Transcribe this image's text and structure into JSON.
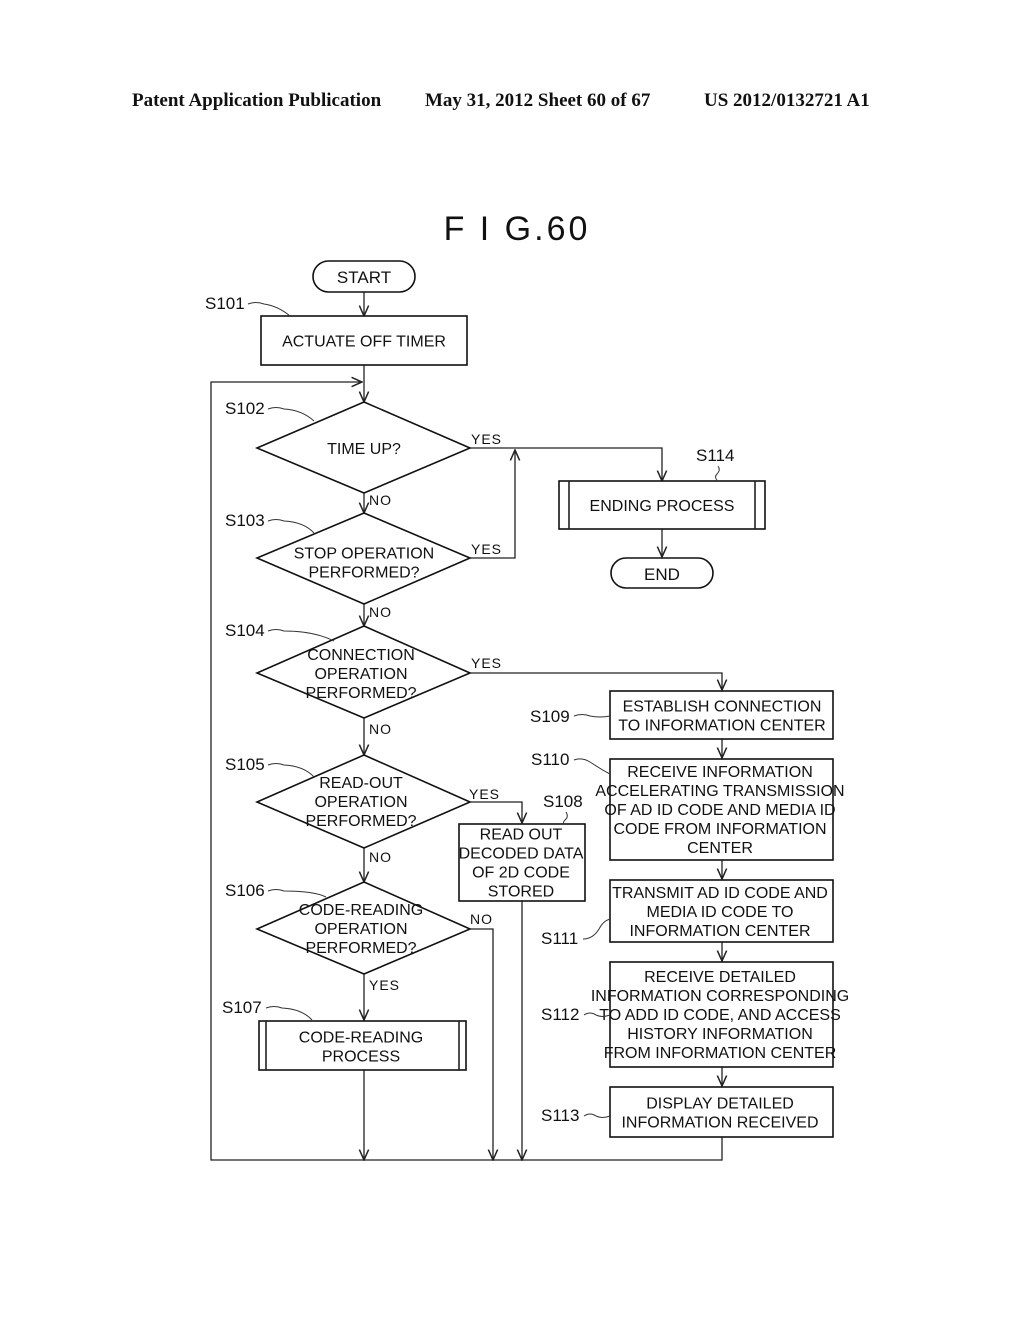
{
  "header": {
    "publication": "Patent Application Publication",
    "date_sheet": "May 31, 2012  Sheet 60 of 67",
    "patent_number": "US 2012/0132721 A1"
  },
  "figure": {
    "title": "F I G.60"
  },
  "terminals": {
    "start": "START",
    "end": "END"
  },
  "steps": {
    "s101": {
      "id": "S101",
      "lines": [
        "ACTUATE OFF TIMER"
      ]
    },
    "s102": {
      "id": "S102",
      "lines": [
        "TIME UP?"
      ]
    },
    "s103": {
      "id": "S103",
      "lines": [
        "STOP OPERATION",
        "PERFORMED?"
      ]
    },
    "s104": {
      "id": "S104",
      "lines": [
        "CONNECTION",
        "OPERATION",
        "PERFORMED?"
      ]
    },
    "s105": {
      "id": "S105",
      "lines": [
        "READ-OUT",
        "OPERATION",
        "PERFORMED?"
      ]
    },
    "s106": {
      "id": "S106",
      "lines": [
        "CODE-READING",
        "OPERATION",
        "PERFORMED?"
      ]
    },
    "s107": {
      "id": "S107",
      "lines": [
        "CODE-READING",
        "PROCESS"
      ]
    },
    "s108": {
      "id": "S108",
      "lines": [
        "READ OUT",
        "DECODED DATA",
        "OF 2D CODE",
        "STORED"
      ]
    },
    "s109": {
      "id": "S109",
      "lines": [
        "ESTABLISH CONNECTION",
        "TO INFORMATION CENTER"
      ]
    },
    "s110": {
      "id": "S110",
      "lines": [
        "RECEIVE INFORMATION",
        "ACCELERATING TRANSMISSION",
        "OF AD ID CODE AND MEDIA ID",
        "CODE FROM INFORMATION",
        "CENTER"
      ]
    },
    "s111": {
      "id": "S111",
      "lines": [
        "TRANSMIT AD ID CODE AND",
        "MEDIA ID CODE TO",
        "INFORMATION CENTER"
      ]
    },
    "s112": {
      "id": "S112",
      "lines": [
        "RECEIVE DETAILED",
        "INFORMATION CORRESPONDING",
        "TO ADD ID CODE, AND ACCESS",
        "HISTORY INFORMATION",
        "FROM INFORMATION CENTER"
      ]
    },
    "s113": {
      "id": "S113",
      "lines": [
        "DISPLAY DETAILED",
        "INFORMATION RECEIVED"
      ]
    },
    "s114": {
      "id": "S114",
      "lines": [
        "ENDING PROCESS"
      ]
    }
  },
  "branch_labels": {
    "s102_yes": "YES",
    "s102_no": "NO",
    "s103_yes": "YES",
    "s103_no": "NO",
    "s104_yes": "YES",
    "s104_no": "NO",
    "s105_yes": "YES",
    "s105_no": "NO",
    "s106_no": "NO",
    "s106_yes": "YES"
  }
}
